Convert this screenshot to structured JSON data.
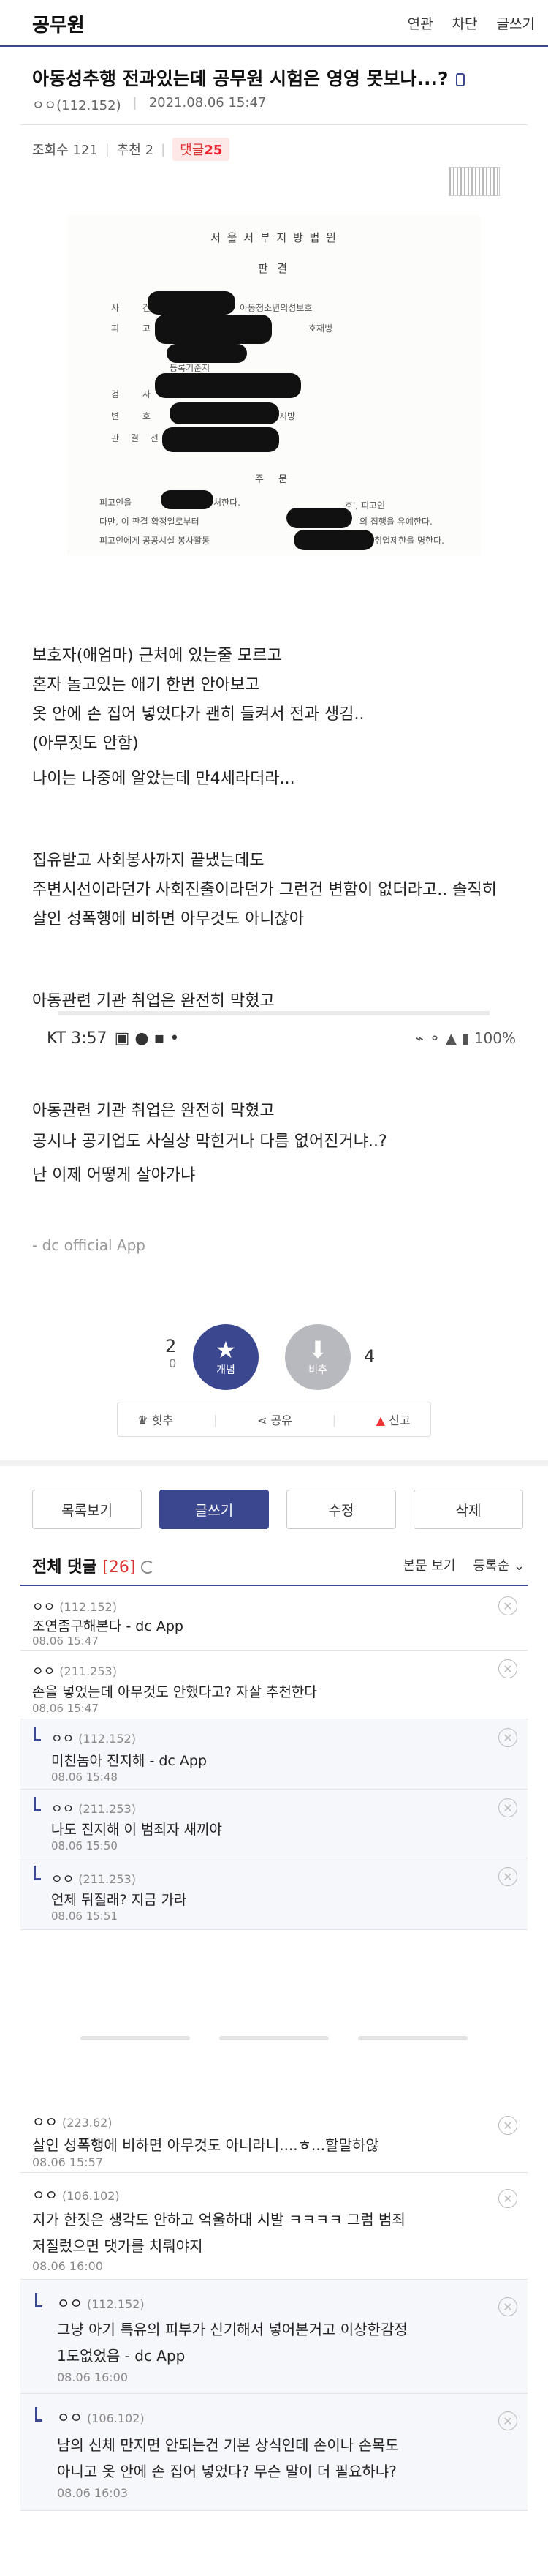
{
  "header": {
    "gallery": "공무원",
    "nav": [
      "연관",
      "차단",
      "글쓰기"
    ]
  },
  "post": {
    "title": "아동성추행 전과있는데 공무원 시험은 영영 못보나...?",
    "author": "ㅇㅇ(112.152)",
    "date": "2021.08.06 15:47",
    "views": "조회수 121",
    "recommends": "추천 2",
    "comments_label": "댓글",
    "comments_count": "25"
  },
  "document": {
    "court": "서 울 서 부 지 방 법 원",
    "type": "판 결",
    "rows": [
      "사 건",
      "피 고 인",
      "",
      "",
      "검 사",
      "변 호 인",
      "판 결 선 고"
    ],
    "case_label": "아동청소년의성보호",
    "section": "주 문",
    "lines": [
      "피고인을",
      "다만, 이 판결 확정일로부터",
      "피고인에게 공공시설 봉사활동"
    ],
    "fragments": [
      "처한다.",
      "의 집행을 유예한다.",
      "취업제한을 명한다.",
      "호', 피고인",
      "등록기준지",
      "지방",
      "호재벙"
    ]
  },
  "body_paragraphs": [
    "보호자(애엄마) 근처에 있는줄 모르고",
    "혼자 놀고있는 애기 한번 안아보고",
    "옷 안에 손 집어 넣었다가 괜히 들켜서 전과 생김..",
    "(아무짓도 안함)",
    "나이는 나중에 알았는데 만4세라더라...",
    "집유받고 사회봉사까지 끝냈는데도",
    "주변시선이라던가 사회진출이라던가 그런건 변함이 없더라고.. 솔직히",
    "살인 성폭행에 비하면 아무것도 아니잖아",
    "아동관련 기관 취업은 완전히 막혔고"
  ],
  "screenshot": {
    "carrier_time": "KT 3:57",
    "battery": "100%"
  },
  "body_paragraphs_2": [
    "아동관련 기관 취업은 완전히 막혔고",
    "공시나 공기업도 사실상 막힌거나 다름 없어진거냐..?",
    "난 이제 어떻게 살아가냐",
    "- dc official App"
  ],
  "votes": {
    "up_count": "2",
    "up_sub": "0",
    "up_label": "개념",
    "down_count": "4",
    "down_label": "비추"
  },
  "actions": [
    "힛추",
    "공유",
    "신고"
  ],
  "buttons": [
    "목록보기",
    "글쓰기",
    "수정",
    "삭제"
  ],
  "comments_header": {
    "title": "전체 댓글",
    "count": "[26]",
    "view": "본문 보기",
    "sort": "등록순"
  },
  "comments": [
    {
      "nick": "ㅇㅇ",
      "ip": "(112.152)",
      "text": [
        "조연좀구해본다 - dc App"
      ],
      "date": "08.06 15:47",
      "reply": false
    },
    {
      "nick": "ㅇㅇ",
      "ip": "(211.253)",
      "text": [
        "손을 넣었는데 아무것도 안했다고? 자살 추천한다"
      ],
      "date": "08.06 15:47",
      "reply": false
    },
    {
      "nick": "ㅇㅇ",
      "ip": "(112.152)",
      "text": [
        "미친놈아 진지해 - dc App"
      ],
      "date": "08.06 15:48",
      "reply": true
    },
    {
      "nick": "ㅇㅇ",
      "ip": "(211.253)",
      "text": [
        "나도 진지해 이 범죄자 새끼야"
      ],
      "date": "08.06 15:50",
      "reply": true
    },
    {
      "nick": "ㅇㅇ",
      "ip": "(211.253)",
      "text": [
        "언제 뒤질래? 지금 가라"
      ],
      "date": "08.06 15:51",
      "reply": true
    },
    {
      "nick": "ㅇㅇ",
      "ip": "(223.62)",
      "text": [
        "살인 성폭행에 비하면 아무것도 아니라니....ㅎ...할말하않"
      ],
      "date": "08.06 15:57",
      "reply": false
    },
    {
      "nick": "ㅇㅇ",
      "ip": "(106.102)",
      "text": [
        "지가 한짓은 생각도 안하고 억울하대 시발 ㅋㅋㅋㅋ 그럼 범죄",
        "저질렀으면 댓가를 치뤄야지"
      ],
      "date": "08.06 16:00",
      "reply": false
    },
    {
      "nick": "ㅇㅇ",
      "ip": "(112.152)",
      "text": [
        "그냥 아기 특유의 피부가 신기해서 넣어본거고 이상한감정",
        "1도없었음 - dc App"
      ],
      "date": "08.06 16:00",
      "reply": true
    },
    {
      "nick": "ㅇㅇ",
      "ip": "(106.102)",
      "text": [
        "남의 신체 만지면 안되는건 기본 상식인데 손이나 손목도",
        "아니고 옷 안에 손 집어 넣었다? 무슨 말이 더 필요하냐?"
      ],
      "date": "08.06 16:03",
      "reply": true
    }
  ]
}
